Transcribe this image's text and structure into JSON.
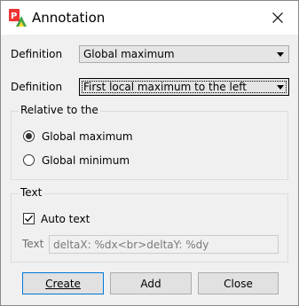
{
  "window": {
    "title": "Annotation",
    "app_icon": "pl-chart-app-icon",
    "close_icon": "close-icon"
  },
  "definition1": {
    "label": "Definition",
    "value": "Global maximum"
  },
  "definition2": {
    "label": "Definition",
    "value": "First local maximum to the left"
  },
  "relative_group": {
    "title": "Relative to the",
    "options": [
      {
        "label": "Global maximum",
        "selected": true
      },
      {
        "label": "Global minimum",
        "selected": false
      }
    ]
  },
  "text_group": {
    "title": "Text",
    "auto_text": {
      "label": "Auto text",
      "checked": true
    },
    "text_field": {
      "label": "Text",
      "value": "deltaX: %dx<br>deltaY: %dy"
    }
  },
  "buttons": {
    "create": "Create",
    "add": "Add",
    "close": "Close"
  }
}
